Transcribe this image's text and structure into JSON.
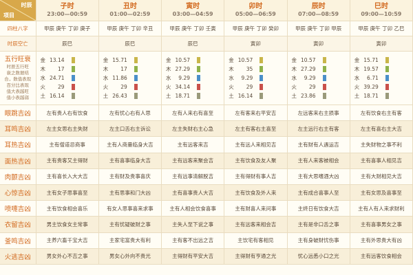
{
  "corner": {
    "top": "时辰",
    "bottom": "项目"
  },
  "columns": [
    {
      "name": "子时",
      "time": "23:00—00:59"
    },
    {
      "name": "丑时",
      "time": "01:00—02:59"
    },
    {
      "name": "寅时",
      "time": "03:00—04:59"
    },
    {
      "name": "卯时",
      "time": "05:00—06:59"
    },
    {
      "name": "辰时",
      "time": "07:00—08:59"
    },
    {
      "name": "巳时",
      "time": "09:00—10:59"
    }
  ],
  "sizhu": {
    "label": "四柱八字",
    "values": [
      "甲辰 庚午 丁卯 庚子",
      "甲辰 庚午 丁卯 辛丑",
      "甲辰 庚午 丁卯 壬寅",
      "甲辰 庚午 丁卯 癸卯",
      "甲辰 庚午 丁卯 甲辰",
      "甲辰 庚午 丁卯 乙巳"
    ]
  },
  "kongwang": {
    "label": "时辰空亡",
    "values": [
      "辰巳",
      "辰巳",
      "辰巳",
      "寅卯",
      "寅卯",
      "寅卯"
    ]
  },
  "wuxing": {
    "label": "五行旺衰",
    "sub": [
      "时辰五行旺",
      "衰之数据结",
      "合，数值表现",
      "百分比表现",
      "值大表越旺",
      "值小表越弱"
    ],
    "elements": [
      "金",
      "木",
      "水",
      "火",
      "土"
    ],
    "colors": {
      "金": "#c9b64a",
      "木": "#8fb24a",
      "水": "#4a8fc9",
      "火": "#c9504a",
      "土": "#9a9a7a"
    },
    "values": [
      [
        13.14,
        17,
        24.71,
        29,
        16.14
      ],
      [
        15.71,
        17,
        11.86,
        29,
        26.43
      ],
      [
        10.57,
        27.29,
        9.29,
        34.14,
        18.71
      ],
      [
        10.57,
        35,
        9.29,
        29,
        16.14
      ],
      [
        10.57,
        27.29,
        9.29,
        29,
        23.86
      ],
      [
        15.71,
        19.57,
        6.71,
        39.29,
        18.71
      ]
    ]
  },
  "rows": [
    {
      "label": "眼跳吉凶",
      "values": [
        "左有贵人右有饮食",
        "左有忧心右有人思",
        "左有人来右有喜至",
        "左有客来右平安吉",
        "左远客来右主损事",
        "左有饮食右主有客"
      ]
    },
    {
      "label": "耳鸣吉凶",
      "values": [
        "左主女思右主失财",
        "左主口舌右主诉讼",
        "左主失财右主心急",
        "左主有客右主喜至",
        "左主远行右主有客",
        "左主有喜右主大吉"
      ]
    },
    {
      "label": "耳热吉凶",
      "values": [
        "主有僧道忌商事",
        "主有人商量临身大吉",
        "主有远客来吉",
        "主有远人来相见吉",
        "主有财有人遇运吉",
        "主失财物之事不利"
      ]
    },
    {
      "label": "面热吉凶",
      "values": [
        "主有贵客又主得财",
        "主有喜事临身大吉",
        "主有远客来聚会吉",
        "主有饮食及友人聚",
        "主有人来客被相会",
        "主有喜事人相见吉"
      ]
    },
    {
      "label": "肉颤吉凶",
      "values": [
        "主有喜长入大大吉",
        "主有财及贵事喜庆",
        "主有远事清解脱吉",
        "主有得财有事人吉",
        "主有大思嗜酒大凶",
        "主有大财相见大吉"
      ]
    },
    {
      "label": "心惊吉凶",
      "values": [
        "主有女子思事喜至",
        "主有思事和门大凶",
        "主有喜事贵人大吉",
        "主有饮食及外人来",
        "主有成合喜事人至",
        "主有女思及喜事至"
      ]
    },
    {
      "label": "喷嚏吉凶",
      "values": [
        "主有饮食相会喜乐",
        "有女人思事喜来求事",
        "主有人相会饮食喜事",
        "主有财喜人来问事",
        "主终日有饮食大吉",
        "主有人有人来求财利"
      ]
    },
    {
      "label": "衣留吉凶",
      "values": [
        "男主饮食女主常事",
        "主有忧疑破财之事",
        "主失人至下说之事",
        "主有远客来相会吉",
        "主有是非口舌之事",
        "主有喜事男女之事"
      ]
    },
    {
      "label": "釜鸣吉凶",
      "values": [
        "主养六畜千宝大吉",
        "主家宅富贵大有利",
        "主有客不出远之吉",
        "主饮宅有客相见",
        "主有身破财忧伤事",
        "主有外思贵大有凶"
      ]
    },
    {
      "label": "火逃吉凶",
      "values": [
        "男女外心不吉之事",
        "男女心外向不贵光",
        "主得财有平安大吉",
        "主得财有亨通之光",
        "忧心远悉小口之光",
        "主有远客饮食相会"
      ]
    }
  ]
}
